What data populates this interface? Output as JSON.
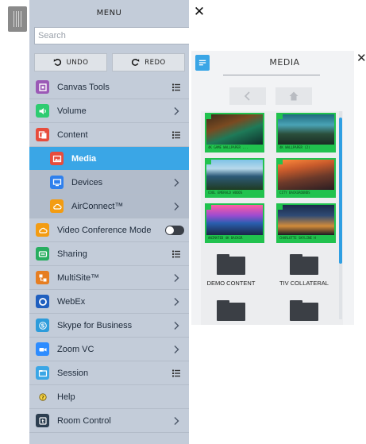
{
  "menu": {
    "title": "MENU",
    "search_placeholder": "Search",
    "undo_label": "UNDO",
    "redo_label": "REDO",
    "items": [
      {
        "label": "Canvas Tools",
        "icon": "canvas-tools-icon",
        "color": "#9b59b6",
        "action": "list"
      },
      {
        "label": "Volume",
        "icon": "volume-icon",
        "color": "#2ecc71",
        "action": "chevron"
      },
      {
        "label": "Content",
        "icon": "content-icon",
        "color": "#e74c3c",
        "action": "list"
      },
      {
        "label": "Media",
        "icon": "media-icon",
        "color": "#e74c3c",
        "action": "none",
        "sub": true,
        "active": true
      },
      {
        "label": "Devices",
        "icon": "devices-icon",
        "color": "#2f80ed",
        "action": "chevron",
        "sub": true
      },
      {
        "label": "AirConnect™",
        "icon": "cloud-icon",
        "color": "#f39c12",
        "action": "chevron",
        "sub": true
      },
      {
        "label": "Video Conference Mode",
        "icon": "cloud-icon",
        "color": "#f39c12",
        "action": "toggle"
      },
      {
        "label": "Sharing",
        "icon": "sharing-icon",
        "color": "#27ae60",
        "action": "list"
      },
      {
        "label": "MultiSite™",
        "icon": "multisite-icon",
        "color": "#e67e22",
        "action": "chevron"
      },
      {
        "label": "WebEx",
        "icon": "webex-icon",
        "color": "#1f5fbf",
        "action": "chevron"
      },
      {
        "label": "Skype for Business",
        "icon": "skype-icon",
        "color": "#2d9cdb",
        "action": "chevron"
      },
      {
        "label": "Zoom VC",
        "icon": "zoom-icon",
        "color": "#2d8cff",
        "action": "chevron"
      },
      {
        "label": "Session",
        "icon": "session-icon",
        "color": "#3aa6e6",
        "action": "list"
      },
      {
        "label": "Help",
        "icon": "help-icon",
        "color": "#f1c40f",
        "action": "none"
      },
      {
        "label": "Room Control",
        "icon": "room-control-icon",
        "color": "#2c3e50",
        "action": "chevron"
      }
    ]
  },
  "media": {
    "title": "MEDIA",
    "thumbnails": [
      {
        "caption": "4K GAME WALLPAPER ..."
      },
      {
        "caption": "4K WALLPAPER (2)"
      },
      {
        "caption": "COOL EMERALD WOODS"
      },
      {
        "caption": "CITY BACKGROUNDS"
      },
      {
        "caption": "ANIMATED 4K BACKGR"
      },
      {
        "caption": "CHARLOTTE SKYLINE H"
      }
    ],
    "folders": [
      {
        "label": "DEMO CONTENT"
      },
      {
        "label": "TIV COLLATERAL"
      },
      {
        "label": ""
      },
      {
        "label": ""
      }
    ]
  }
}
